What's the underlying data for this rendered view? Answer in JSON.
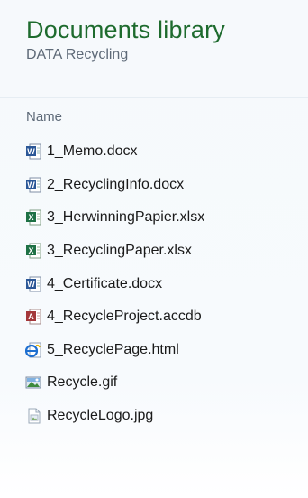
{
  "library": {
    "title": "Documents library",
    "subtitle": "DATA Recycling"
  },
  "columns": {
    "name": "Name"
  },
  "files": [
    {
      "name": "1_Memo.docx",
      "icon": "word-doc-icon"
    },
    {
      "name": "2_RecyclingInfo.docx",
      "icon": "word-doc-icon"
    },
    {
      "name": "3_HerwinningPapier.xlsx",
      "icon": "excel-sheet-icon"
    },
    {
      "name": "3_RecyclingPaper.xlsx",
      "icon": "excel-sheet-icon"
    },
    {
      "name": "4_Certificate.docx",
      "icon": "word-doc-icon"
    },
    {
      "name": "4_RecycleProject.accdb",
      "icon": "access-db-icon"
    },
    {
      "name": "5_RecyclePage.html",
      "icon": "html-page-icon"
    },
    {
      "name": "Recycle.gif",
      "icon": "gif-image-icon"
    },
    {
      "name": "RecycleLogo.jpg",
      "icon": "jpg-image-icon"
    }
  ],
  "colors": {
    "title": "#1e6b2e",
    "subtitle": "#5e6a78",
    "word": "#2b5797",
    "excel": "#1e7145",
    "access": "#a4373a",
    "html": "#1e6fd0"
  }
}
